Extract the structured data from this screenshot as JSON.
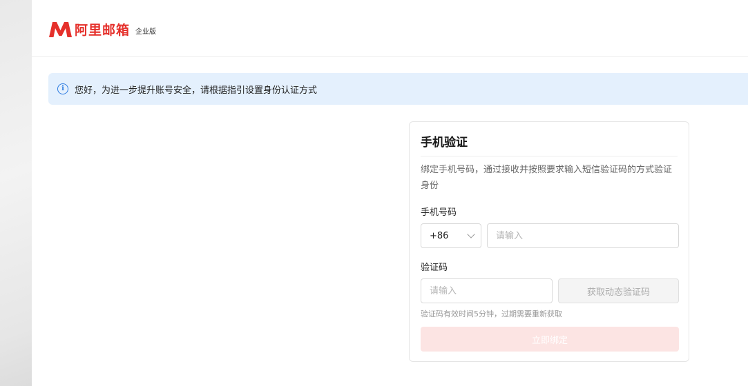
{
  "brand": {
    "name": "阿里邮箱",
    "edition": "企业版",
    "accent_color": "#e5302b"
  },
  "notice": {
    "icon": "info-icon",
    "text": "您好，为进一步提升账号安全，请根据指引设置身份认证方式"
  },
  "card": {
    "title": "手机验证",
    "description": "绑定手机号码，通过接收并按照要求输入短信验证码的方式验证身份",
    "phone": {
      "label": "手机号码",
      "country_code": "+86",
      "placeholder": "请输入"
    },
    "code": {
      "label": "验证码",
      "placeholder": "请输入",
      "get_code_label": "获取动态验证码",
      "hint": "验证码有效时间5分钟，过期需要重新获取"
    },
    "submit_label": "立即绑定"
  }
}
